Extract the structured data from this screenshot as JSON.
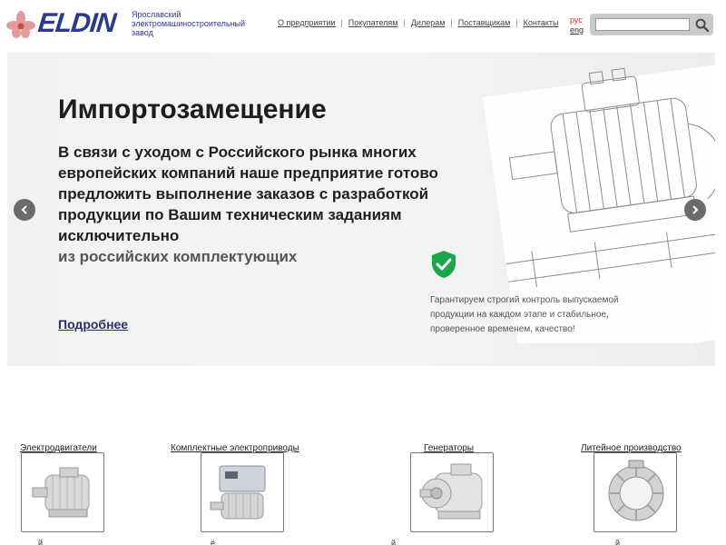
{
  "header": {
    "logo_text": "ELDIN",
    "tagline": "Ярославский электромашиностроительный завод",
    "nav": [
      {
        "label": "О предприятии"
      },
      {
        "label": "Покупателям"
      },
      {
        "label": "Дилерам"
      },
      {
        "label": "Поставщикам"
      },
      {
        "label": "Контакты"
      }
    ],
    "lang_ru": "рус",
    "lang_en": "eng",
    "search_value": "",
    "search_placeholder": ""
  },
  "hero": {
    "title": "Импортозамещение",
    "text_main": "В связи с уходом с Российского рынка многих европейских компаний наше предприятие готово предложить выполнение заказов с разработкой продукции по Вашим техническим заданиям исключительно",
    "text_muted": "из российских комплектующих",
    "more_label": "Подробнее",
    "guarantee": "Гарантируем строгий контроль выпускаемой продукции на каждом этапе и стабильное, проверенное временем, качество!",
    "accent_color": "#1aa64b",
    "arrow_left_icon": "chevron-left-icon",
    "arrow_right_icon": "chevron-right-icon"
  },
  "products": [
    {
      "label": "Электродвигатели",
      "caption": "й"
    },
    {
      "label": "Комплектные электроприводы",
      "caption": "ё"
    },
    {
      "label": "Генераторы",
      "caption": "й"
    },
    {
      "label": "Литейное производство",
      "caption": "й"
    }
  ]
}
